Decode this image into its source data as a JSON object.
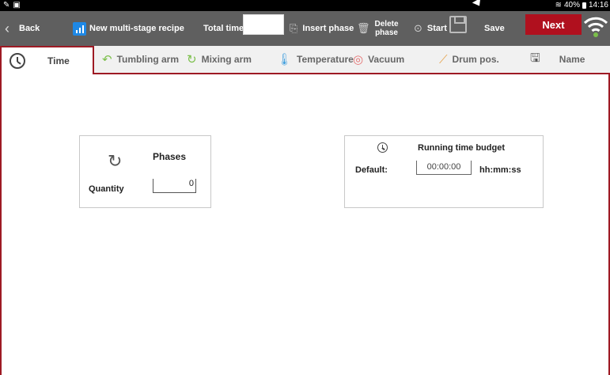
{
  "statusbar": {
    "battery": "40%",
    "time": "14:16"
  },
  "toolbar": {
    "back_label": "Back",
    "new_recipe_label": "New multi-stage recipe",
    "total_time_label": "Total time:",
    "total_time_value": "",
    "insert_phase_label": "Insert phase",
    "delete_phase_line1": "Delete",
    "delete_phase_line2": "phase",
    "start_label": "Start",
    "save_label": "Save",
    "next_label": "Next"
  },
  "tabs": [
    {
      "label": "Time",
      "active": true
    },
    {
      "label": "Tumbling arm"
    },
    {
      "label": "Mixing arm"
    },
    {
      "label": "Temperature"
    },
    {
      "label": "Vacuum"
    },
    {
      "label": "Drum pos."
    },
    {
      "label": "Name"
    }
  ],
  "phases_card": {
    "title": "Phases",
    "quantity_label": "Quantity",
    "quantity_value": "0"
  },
  "budget_card": {
    "title": "Running time budget",
    "default_label": "Default:",
    "default_value": "00:00:00",
    "unit": "hh:mm:ss"
  },
  "colors": {
    "accent": "#9e1a24",
    "next_button": "#b0101e",
    "toolbar": "#5f5f5f"
  }
}
